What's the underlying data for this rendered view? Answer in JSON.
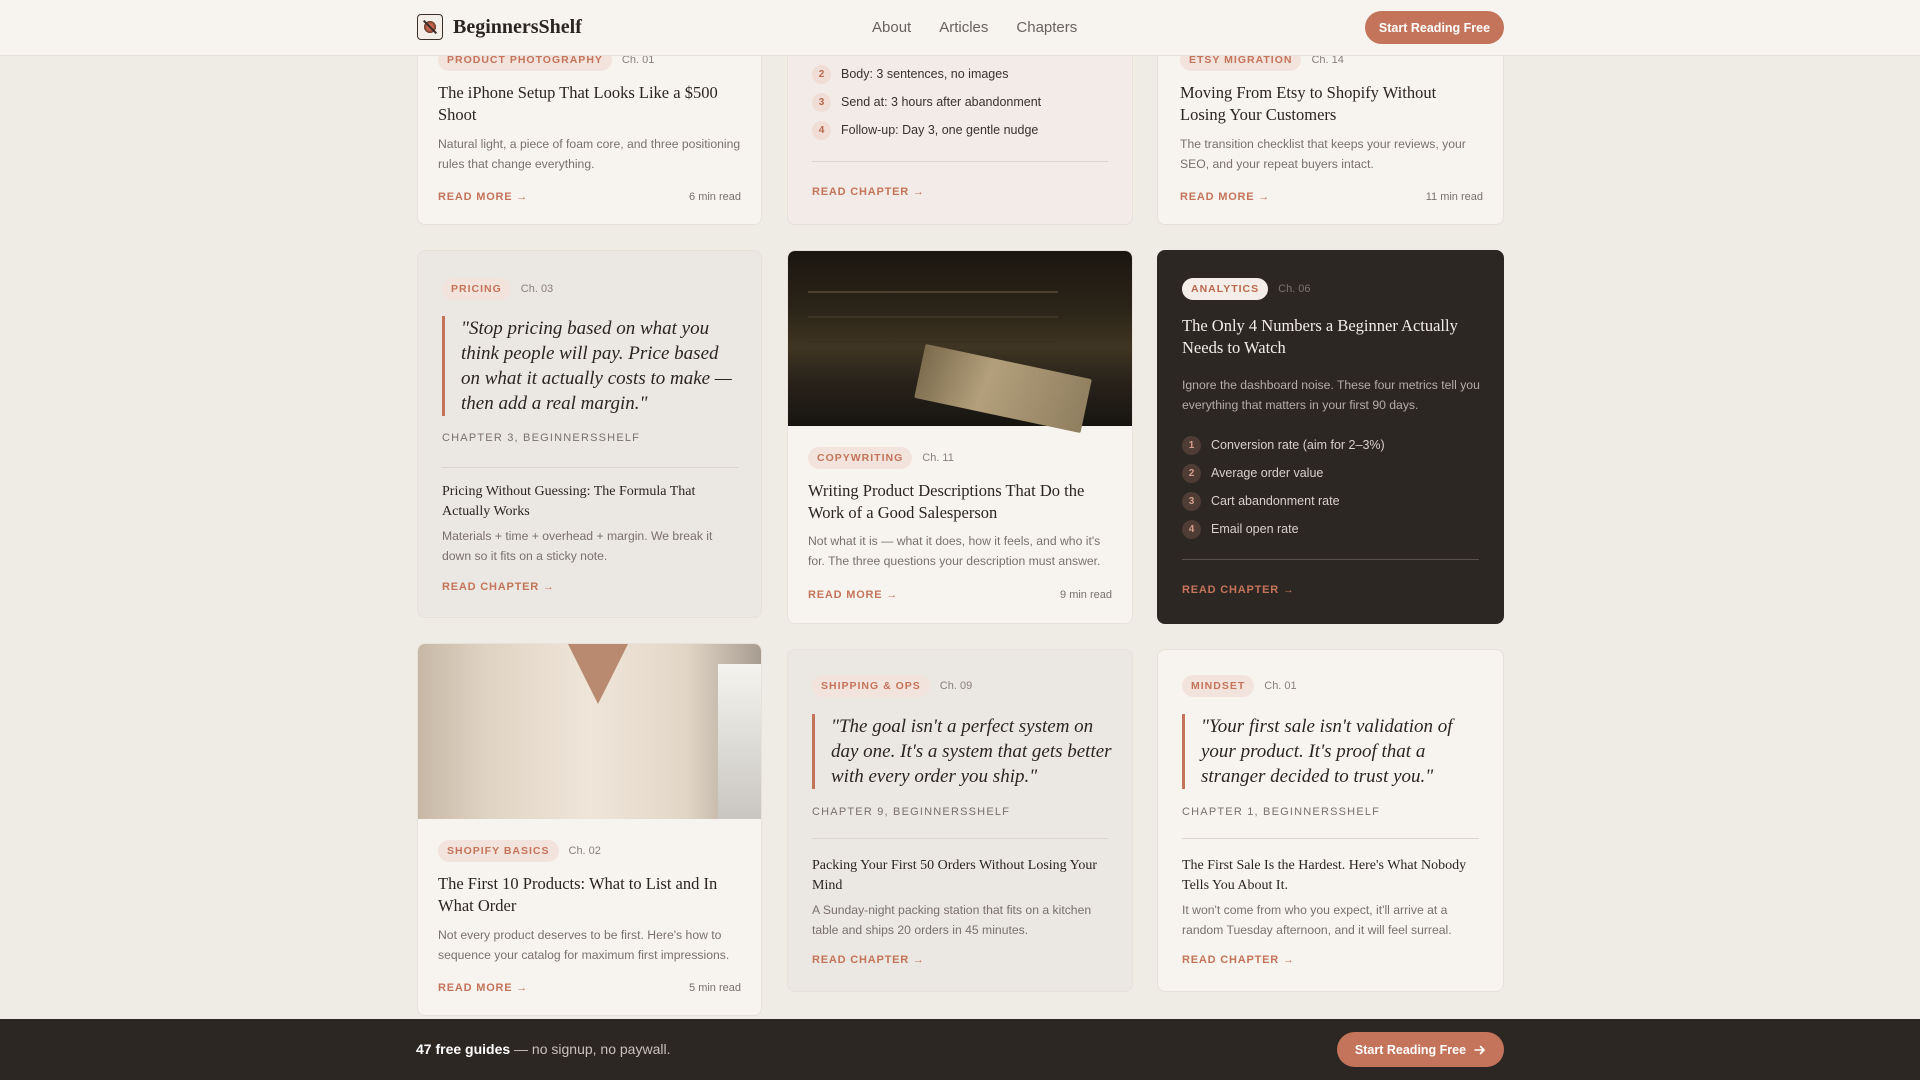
{
  "header": {
    "brand": "BeginnersShelf",
    "nav": [
      "About",
      "Articles",
      "Chapters"
    ],
    "cta": "Start Reading Free"
  },
  "cards": {
    "photography": {
      "tag": "PRODUCT PHOTOGRAPHY",
      "chapter": "Ch. 01",
      "title": "The iPhone Setup That Looks Like a $500 Shoot",
      "desc": "Natural light, a piece of foam core, and three positioning rules that change everything.",
      "more": "READ MORE →",
      "time": "6 min read"
    },
    "email": {
      "items": [
        {
          "n": "2",
          "text": "Body: 3 sentences, no images"
        },
        {
          "n": "3",
          "text": "Send at: 3 hours after abandonment"
        },
        {
          "n": "4",
          "text": "Follow-up: Day 3, one gentle nudge"
        }
      ],
      "more": "READ CHAPTER →"
    },
    "etsy": {
      "tag": "ETSY MIGRATION",
      "chapter": "Ch. 14",
      "title": "Moving From Etsy to Shopify Without Losing Your Customers",
      "desc": "The transition checklist that keeps your reviews, your SEO, and your repeat buyers intact.",
      "more": "READ MORE →",
      "time": "11 min read"
    },
    "pricing": {
      "tag": "PRICING",
      "chapter": "Ch. 03",
      "quote": "\"Stop pricing based on what you think people will pay. Price based on what it actually costs to make — then add a real margin.\"",
      "attr": "CHAPTER 3, BEGINNERSSHELF",
      "subtitle": "Pricing Without Guessing: The Formula That Actually Works",
      "desc": "Materials + time + overhead + margin. We break it down so it fits on a sticky note.",
      "more": "READ CHAPTER →"
    },
    "copywriting": {
      "tag": "COPYWRITING",
      "chapter": "Ch. 11",
      "title": "Writing Product Descriptions That Do the Work of a Good Salesperson",
      "desc": "Not what it is — what it does, how it feels, and who it's for. The three questions your description must answer.",
      "more": "READ MORE →",
      "time": "9 min read"
    },
    "analytics": {
      "tag": "ANALYTICS",
      "chapter": "Ch. 06",
      "title": "The Only 4 Numbers a Beginner Actually Needs to Watch",
      "desc": "Ignore the dashboard noise. These four metrics tell you everything that matters in your first 90 days.",
      "items": [
        {
          "n": "1",
          "text": "Conversion rate (aim for 2–3%)"
        },
        {
          "n": "2",
          "text": "Average order value"
        },
        {
          "n": "3",
          "text": "Cart abandonment rate"
        },
        {
          "n": "4",
          "text": "Email open rate"
        }
      ],
      "more": "READ CHAPTER →"
    },
    "shopify": {
      "tag": "SHOPIFY BASICS",
      "chapter": "Ch. 02",
      "title": "The First 10 Products: What to List and In What Order",
      "desc": "Not every product deserves to be first. Here's how to sequence your catalog for maximum first impressions.",
      "more": "READ MORE →",
      "time": "5 min read"
    },
    "shipping": {
      "tag": "SHIPPING & OPS",
      "chapter": "Ch. 09",
      "quote": "\"The goal isn't a perfect system on day one. It's a system that gets better with every order you ship.\"",
      "attr": "CHAPTER 9, BEGINNERSSHELF",
      "subtitle": "Packing Your First 50 Orders Without Losing Your Mind",
      "desc": "A Sunday-night packing station that fits on a kitchen table and ships 20 orders in 45 minutes.",
      "more": "READ CHAPTER →"
    },
    "mindset": {
      "tag": "MINDSET",
      "chapter": "Ch. 01",
      "quote": "\"Your first sale isn't validation of your product. It's proof that a stranger decided to trust you.\"",
      "attr": "CHAPTER 1, BEGINNERSSHELF",
      "subtitle": "The First Sale Is the Hardest. Here's What Nobody Tells You About It.",
      "desc": "It won't come from who you expect, it'll arrive at a random Tuesday afternoon, and it will feel surreal.",
      "more": "READ CHAPTER →"
    }
  },
  "footer": {
    "count": "47 free guides",
    "text": " — no signup, no paywall.",
    "cta": "Start Reading Free"
  }
}
